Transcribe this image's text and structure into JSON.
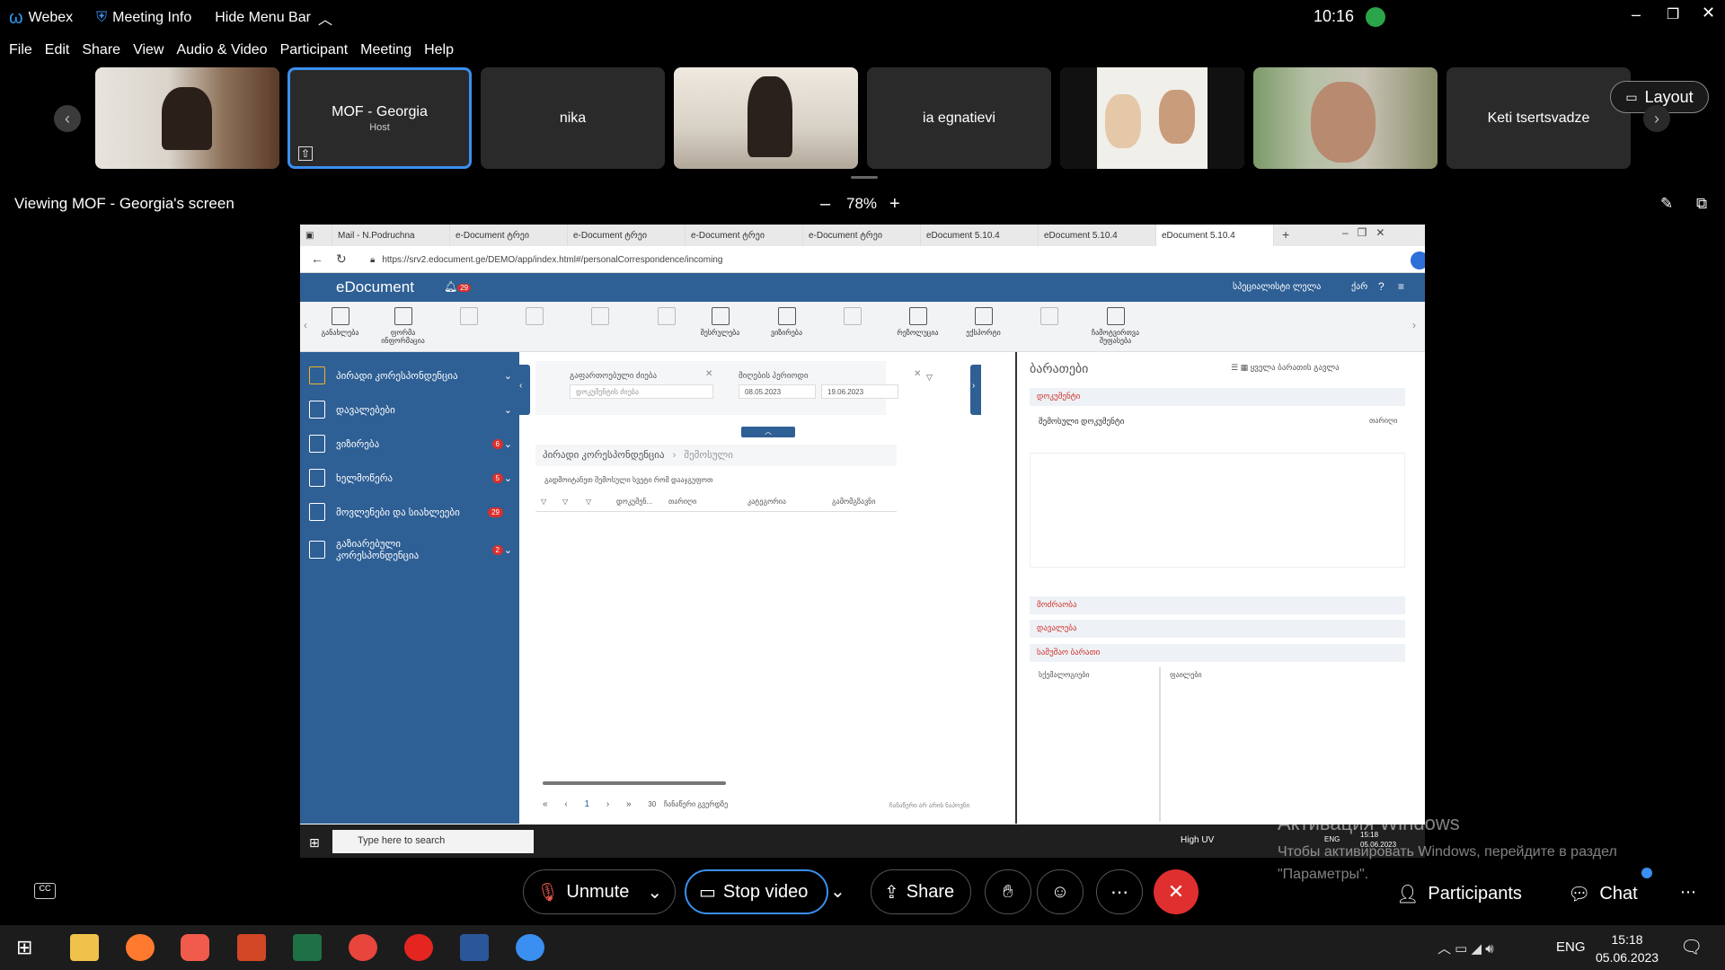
{
  "topbar": {
    "app_name": "Webex",
    "meeting_info": "Meeting Info",
    "hide_menu": "Hide Menu Bar",
    "time": "10:16"
  },
  "menu": [
    "File",
    "Edit",
    "Share",
    "View",
    "Audio & Video",
    "Participant",
    "Meeting",
    "Help"
  ],
  "participants": [
    {
      "name": "",
      "video": true
    },
    {
      "name": "MOF - Georgia",
      "role": "Host",
      "video": false
    },
    {
      "name": "nika",
      "video": false
    },
    {
      "name": "",
      "video": true
    },
    {
      "name": "ia egnatievi",
      "video": false
    },
    {
      "name": "",
      "video": true
    },
    {
      "name": "",
      "video": true
    },
    {
      "name": "Keti tsertsvadze",
      "video": false
    }
  ],
  "layout_label": "Layout",
  "viewing": {
    "label": "Viewing MOF - Georgia's screen",
    "zoom": "78%"
  },
  "browser": {
    "tabs": [
      "Mail - N.Podruchna",
      "e-Document ტრეი",
      "e-Document ტრეი",
      "e-Document ტრეი",
      "e-Document ტრეი",
      "eDocument 5.10.4",
      "eDocument 5.10.4",
      "eDocument 5.10.4"
    ],
    "url": "https://srv2.edocument.ge/DEMO/app/index.html#/personalCorrespondence/incoming"
  },
  "edoc": {
    "logo": "eDocument",
    "notif": "29",
    "user": "სპეციალისტი ლელა",
    "lang": "ქარ",
    "toolbar": [
      "განახლება",
      "ფორმა ინფორმაცია",
      "",
      "",
      "",
      "",
      "შესრულება",
      "ვიზირება",
      "",
      "რეზოლუცია",
      "ექსპორტი",
      "",
      "ჩამოტვირთვა შეფასება"
    ],
    "sidebar": [
      {
        "label": "პირადი კორესპონდენცია",
        "badge": ""
      },
      {
        "label": "დავალებები",
        "badge": ""
      },
      {
        "label": "ვიზირება",
        "badge": "6"
      },
      {
        "label": "ხელმოწერა",
        "badge": "5"
      },
      {
        "label": "მოვლენები და სიახლეები",
        "badge": "29"
      },
      {
        "label": "გაზიარებული კორესპონდენცია",
        "badge": "2"
      }
    ],
    "filter_search_label": "გაფართოებული ძიება",
    "filter_search_placeholder": "დოკუმენტის ძიება",
    "period_label": "მიღების პერიოდი",
    "date_from": "08.05.2023",
    "date_to": "19.06.2023",
    "breadcrumb_root": "პირადი კორესპონდენცია",
    "breadcrumb_leaf": "შემოსული",
    "hint": "გადმოიტანეთ შემოსული სვეტი რომ დააჯგუფოთ",
    "columns": [
      "დოკუმენ...",
      "თარიღი",
      "კატეგორია",
      "გამომგზავნი"
    ],
    "pager_page": "1",
    "pager_size": "30",
    "pager_label": "ჩანაწერი გვერდზე",
    "no_records": "ჩანაწერი არ არის ნაპოვნი",
    "right_title": "ბარათები",
    "right_all": "ყველა ბარათის გავლა",
    "sec1": "დოკუმენტი",
    "doc_type": "შემოსული დოკუმენტი",
    "doc_date": "თარიღი",
    "sec2": "მოძრაობა",
    "sec3": "დავალება",
    "sec4": "სამუშაო ბარათი",
    "wc_left": "სქემალოგიები",
    "wc_right": "ფაილები"
  },
  "win_remote": {
    "search": "Type here to search",
    "uv": "High UV",
    "lang": "ENG",
    "time": "15:18",
    "date": "05.06.2023"
  },
  "activation": {
    "title": "Активация Windows",
    "line": "Чтобы активировать Windows, перейдите в раздел \"Параметры\"."
  },
  "controls": {
    "unmute": "Unmute",
    "stop_video": "Stop video",
    "share": "Share",
    "participants": "Participants",
    "chat": "Chat"
  },
  "taskbar": {
    "lang": "ENG",
    "time": "15:18",
    "date": "05.06.2023"
  }
}
